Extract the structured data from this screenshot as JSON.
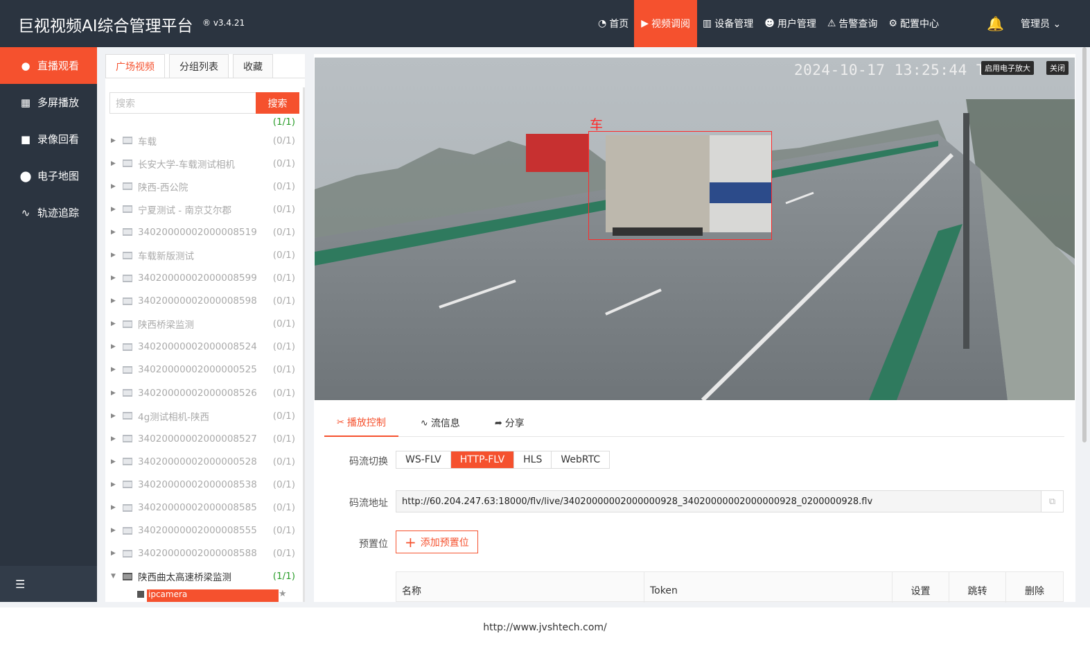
{
  "header": {
    "brand": "巨视视频AI综合管理平台",
    "version": "® v3.4.21",
    "nav": [
      {
        "label": "首页",
        "icon": "dashboard-icon"
      },
      {
        "label": "视频调阅",
        "icon": "play-circle-icon"
      },
      {
        "label": "设备管理",
        "icon": "device-icon"
      },
      {
        "label": "用户管理",
        "icon": "user-icon"
      },
      {
        "label": "告警查询",
        "icon": "alarm-icon"
      },
      {
        "label": "配置中心",
        "icon": "gear-icon"
      }
    ],
    "active_nav": "视频调阅",
    "user": "管理员 ⌄"
  },
  "sidebar": {
    "items": [
      {
        "label": "直播观看",
        "icon": "play-circle-icon"
      },
      {
        "label": "多屏播放",
        "icon": "layout-icon"
      },
      {
        "label": "录像回看",
        "icon": "video-camera-icon"
      },
      {
        "label": "电子地图",
        "icon": "map-pin-icon"
      },
      {
        "label": "轨迹追踪",
        "icon": "track-icon"
      }
    ],
    "active": "直播观看"
  },
  "tree_panel": {
    "tabs": [
      "广场视频",
      "分组列表",
      "收藏"
    ],
    "active_tab": "广场视频",
    "search_placeholder": "搜索",
    "search_button": "搜索",
    "partial_row_count": "(1/1)",
    "nodes": [
      {
        "name": "车载",
        "count": "(0/1)"
      },
      {
        "name": "长安大学-车载测试相机",
        "count": "(0/1)"
      },
      {
        "name": "陕西-西公院",
        "count": "(0/1)"
      },
      {
        "name": "宁夏测试 - 南京艾尔郡",
        "count": "(0/1)"
      },
      {
        "name": "34020000002000008519",
        "count": "(0/1)"
      },
      {
        "name": "车载新版测试",
        "count": "(0/1)"
      },
      {
        "name": "34020000002000008599",
        "count": "(0/1)"
      },
      {
        "name": "34020000002000008598",
        "count": "(0/1)"
      },
      {
        "name": "陕西桥梁监测",
        "count": "(0/1)"
      },
      {
        "name": "34020000002000008524",
        "count": "(0/1)"
      },
      {
        "name": "34020000002000000525",
        "count": "(0/1)"
      },
      {
        "name": "34020000002000008526",
        "count": "(0/1)"
      },
      {
        "name": "4g测试相机-陕西",
        "count": "(0/1)"
      },
      {
        "name": "34020000002000008527",
        "count": "(0/1)"
      },
      {
        "name": "34020000002000000528",
        "count": "(0/1)"
      },
      {
        "name": "34020000002000008538",
        "count": "(0/1)"
      },
      {
        "name": "34020000002000008585",
        "count": "(0/1)"
      },
      {
        "name": "34020000002000008555",
        "count": "(0/1)"
      },
      {
        "name": "34020000002000008588",
        "count": "(0/1)"
      }
    ],
    "open_node": {
      "name": "陕西曲太高速桥梁监测",
      "count": "(1/1)"
    },
    "selected_child": "ipcamera"
  },
  "video": {
    "timestamp": "2024-10-17 13:25:44 Th",
    "zoom_button": "启用电子放大",
    "close_button": "关闭",
    "detection_label": "车"
  },
  "controls": {
    "tabs": [
      {
        "label": "播放控制",
        "icon": "tools-icon"
      },
      {
        "label": "流信息",
        "icon": "pulse-icon"
      },
      {
        "label": "分享",
        "icon": "share-icon"
      }
    ],
    "active_tab": "播放控制",
    "stream_switch_label": "码流切换",
    "stream_options": [
      "WS-FLV",
      "HTTP-FLV",
      "HLS",
      "WebRTC"
    ],
    "active_stream": "HTTP-FLV",
    "stream_url_label": "码流地址",
    "stream_url": "http://60.204.247.63:18000/flv/live/34020000002000000928_34020000002000000928_0200000928.flv",
    "preset_label": "预置位",
    "add_preset": "添加预置位",
    "preset_table_headers": [
      "名称",
      "Token",
      "设置",
      "跳转",
      "删除"
    ]
  },
  "footer": {
    "link": "http://www.jvshtech.com/"
  },
  "colors": {
    "accent": "#f5512e",
    "header_bg": "#2b3440"
  }
}
